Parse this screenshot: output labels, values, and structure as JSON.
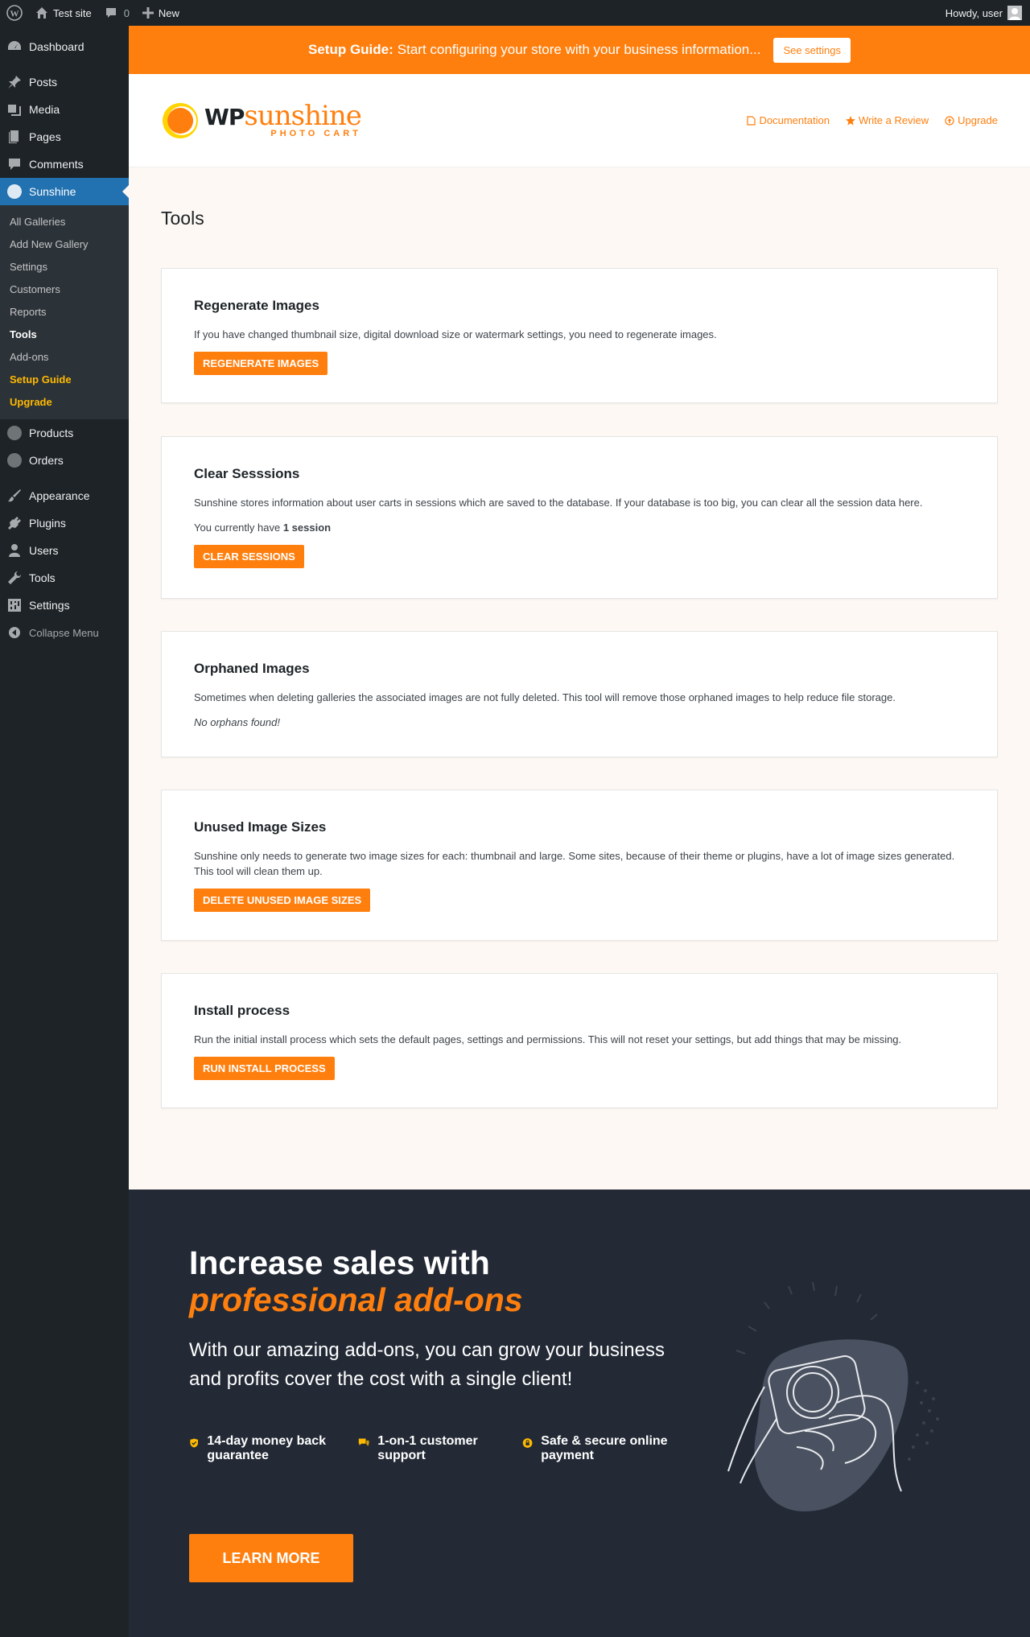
{
  "adminbar": {
    "site_name": "Test site",
    "comments_count": "0",
    "new_label": "New",
    "howdy": "Howdy, user"
  },
  "sidebar": {
    "items_top": [
      {
        "label": "Dashboard",
        "icon": "dashboard-icon"
      },
      {
        "label": "Posts",
        "icon": "pin-icon"
      },
      {
        "label": "Media",
        "icon": "media-icon"
      },
      {
        "label": "Pages",
        "icon": "pages-icon"
      },
      {
        "label": "Comments",
        "icon": "comment-icon"
      },
      {
        "label": "Sunshine",
        "icon": "sunshine-icon"
      }
    ],
    "submenu": [
      {
        "label": "All Galleries"
      },
      {
        "label": "Add New Gallery"
      },
      {
        "label": "Settings"
      },
      {
        "label": "Customers"
      },
      {
        "label": "Reports"
      },
      {
        "label": "Tools"
      },
      {
        "label": "Add-ons"
      },
      {
        "label": "Setup Guide"
      },
      {
        "label": "Upgrade"
      }
    ],
    "items_mid": [
      {
        "label": "Products"
      },
      {
        "label": "Orders"
      }
    ],
    "items_bottom": [
      {
        "label": "Appearance"
      },
      {
        "label": "Plugins"
      },
      {
        "label": "Users"
      },
      {
        "label": "Tools"
      },
      {
        "label": "Settings"
      }
    ],
    "collapse_label": "Collapse Menu"
  },
  "banner": {
    "strong": "Setup Guide:",
    "text": "Start configuring your store with your business information...",
    "button": "See settings"
  },
  "brand": {
    "logo_wp": "WP",
    "logo_sunshine": "sunshine",
    "logo_sub": "PHOTO CART",
    "links": [
      "Documentation",
      "Write a Review",
      "Upgrade"
    ]
  },
  "page_title": "Tools",
  "cards": {
    "regenerate": {
      "title": "Regenerate Images",
      "desc": "If you have changed thumbnail size, digital download size or watermark settings, you need to regenerate images.",
      "button": "REGENERATE IMAGES"
    },
    "sessions": {
      "title": "Clear Sesssions",
      "desc": "Sunshine stores information about user carts in sessions which are saved to the database. If your database is too big, you can clear all the session data here.",
      "count_prefix": "You currently have",
      "count_value": "1 session",
      "button": "CLEAR SESSIONS"
    },
    "orphans": {
      "title": "Orphaned Images",
      "desc": "Sometimes when deleting galleries the associated images are not fully deleted. This tool will remove those orphaned images to help reduce file storage.",
      "status": "No orphans found!"
    },
    "sizes": {
      "title": "Unused Image Sizes",
      "desc": "Sunshine only needs to generate two image sizes for each: thumbnail and large. Some sites, because of their theme or plugins, have a lot of image sizes generated. This tool will clean them up.",
      "button": "DELETE UNUSED IMAGE SIZES"
    },
    "install": {
      "title": "Install process",
      "desc": "Run the initial install process which sets the default pages, settings and permissions. This will not reset your settings, but add things that may be missing.",
      "button": "RUN INSTALL PROCESS"
    }
  },
  "promo": {
    "heading": "Increase sales with",
    "heading_em": "professional add-ons",
    "lead": "With our amazing add-ons, you can grow your business and profits cover the cost with a single client!",
    "features": [
      {
        "label": "14-day money back guarantee",
        "icon": "shield-check-icon"
      },
      {
        "label": "1-on-1 customer support",
        "icon": "chat-icon"
      },
      {
        "label": "Safe & secure online payment",
        "icon": "lock-icon"
      }
    ],
    "button": "LEARN MORE"
  },
  "colors": {
    "accent": "#ff7f0e",
    "admin_bg": "#1d2327",
    "current_menu": "#2271b1",
    "promo_bg": "#232a36"
  }
}
